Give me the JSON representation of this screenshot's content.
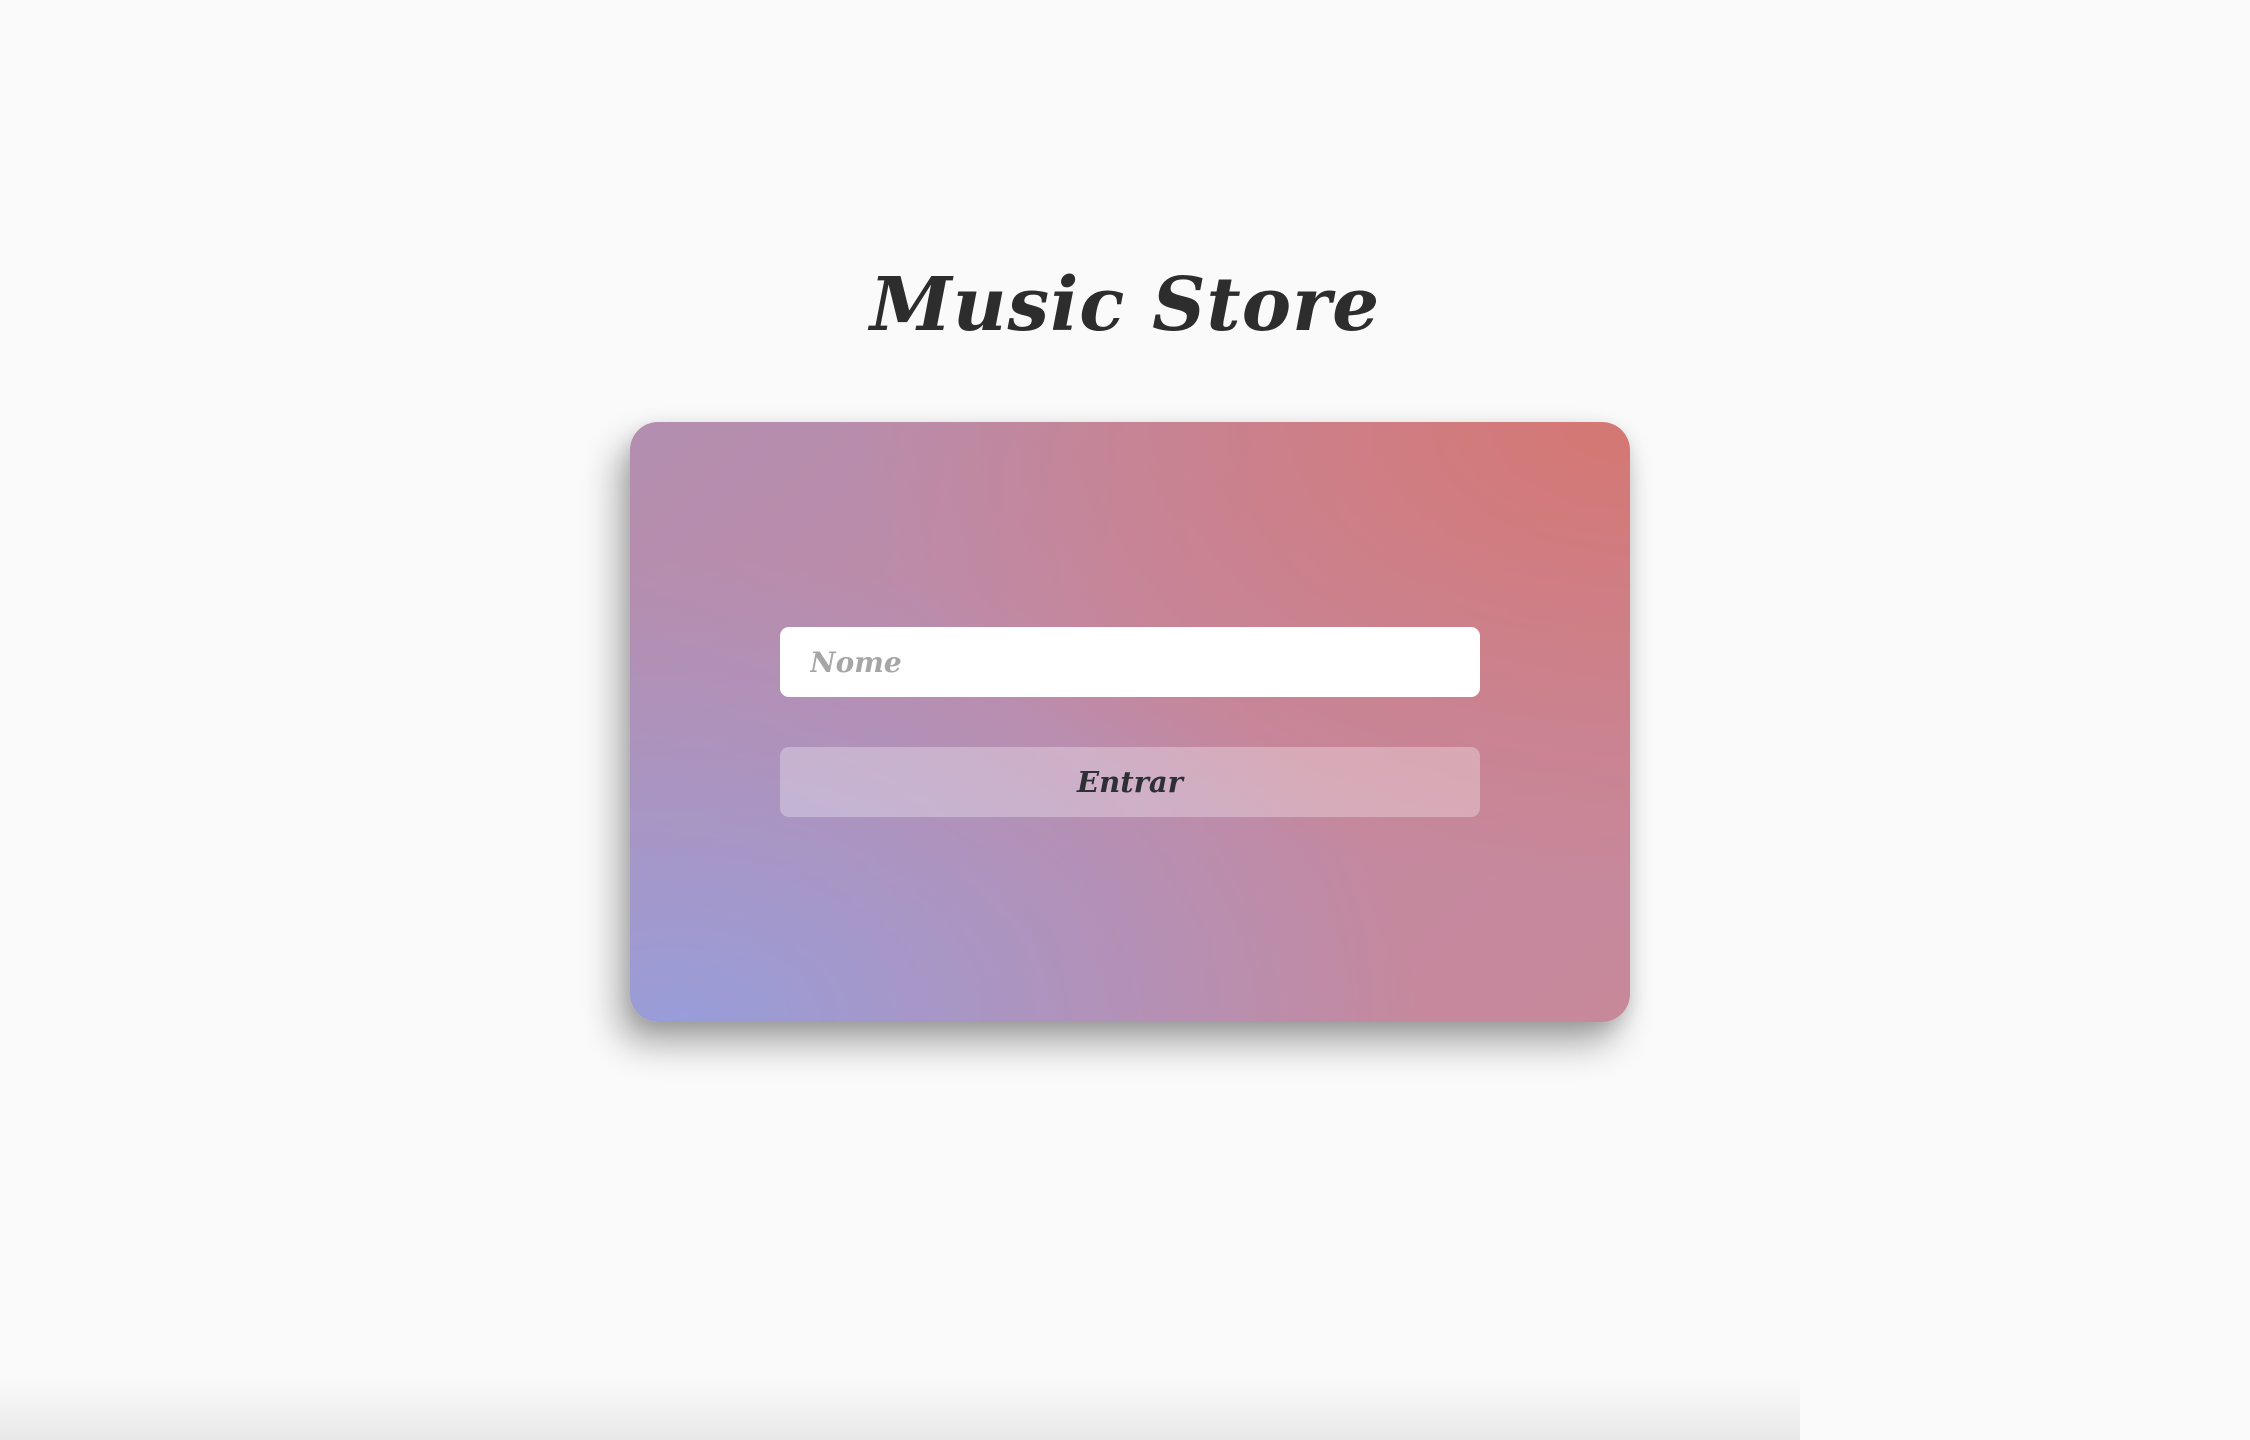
{
  "header": {
    "title": "Music Store"
  },
  "login_card": {
    "name_input": {
      "placeholder": "Nome",
      "value": ""
    },
    "enter_button_label": "Entrar"
  },
  "colors": {
    "background": "#fafafa",
    "title_text": "#2d2d2d",
    "card_gradient_top_right": "#d67670",
    "card_gradient_bottom_left": "#969edc",
    "input_background": "#ffffff",
    "placeholder_text": "#a6a6a6",
    "button_text": "#2f2f36"
  }
}
